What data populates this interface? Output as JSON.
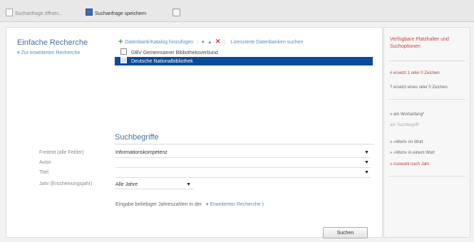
{
  "tabs": [
    {
      "label": "Suchanfrage öffnen..."
    },
    {
      "label": "Suchanfrage speichern"
    },
    {
      "label": ""
    }
  ],
  "left": {
    "heading": "Einfache Recherche",
    "advanced_link": "▾ Zur erweiterten Recherche"
  },
  "toolbar": {
    "add_label": "Datenbank/Katalog hinzufügen",
    "down": "▾",
    "up": "▴",
    "delete": "✕",
    "licensed_label": "Lizenzierte Datenbanken suchen"
  },
  "databases": [
    {
      "label": "GBV Gemeinsamer Bibliotheksverbund",
      "checked": false,
      "selected": false
    },
    {
      "label": "Deutsche Nationalbibliothek",
      "checked": true,
      "selected": true
    }
  ],
  "suchbegriffe": {
    "title": "Suchbegriffe",
    "fields": [
      {
        "label": "Freitext (alle Felder)",
        "value": "Informationskompetenz"
      },
      {
        "label": "Autor",
        "value": ""
      },
      {
        "label": "Titel",
        "value": ""
      },
      {
        "label": "Jahr (Erscheinungsjahr)",
        "value": "Alle Jahre"
      }
    ],
    "hint": "Eingabe beliebiger Jahreszahlen in der",
    "hint_link": "▾ Erweiterten Recherche )",
    "search_button": "Suchen"
  },
  "side": {
    "title": "Verfügbare Platzhalter und Suchoptionen",
    "items": [
      {
        "text": "# ersetzt 1 oder 0 Zeichen",
        "style": "red"
      },
      {
        "text": "? ersetzt eines oder 0 Zeichen",
        "style": "normal"
      },
      {
        "text": "» am Wortanfang*",
        "style": "normal"
      },
      {
        "text": "am Suchbegriff",
        "style": "muted"
      },
      {
        "text": "» »Wort« im Wort",
        "style": "normal"
      },
      {
        "text": "» »Wort« in einem Wort",
        "style": "normal"
      },
      {
        "text": "» Auswahl nach Jahr",
        "style": "red"
      }
    ]
  },
  "colors": {
    "selection": "#0a4a9a",
    "heading": "#4a6e9a",
    "link": "#5a8ac8",
    "side_accent": "#d04040"
  }
}
